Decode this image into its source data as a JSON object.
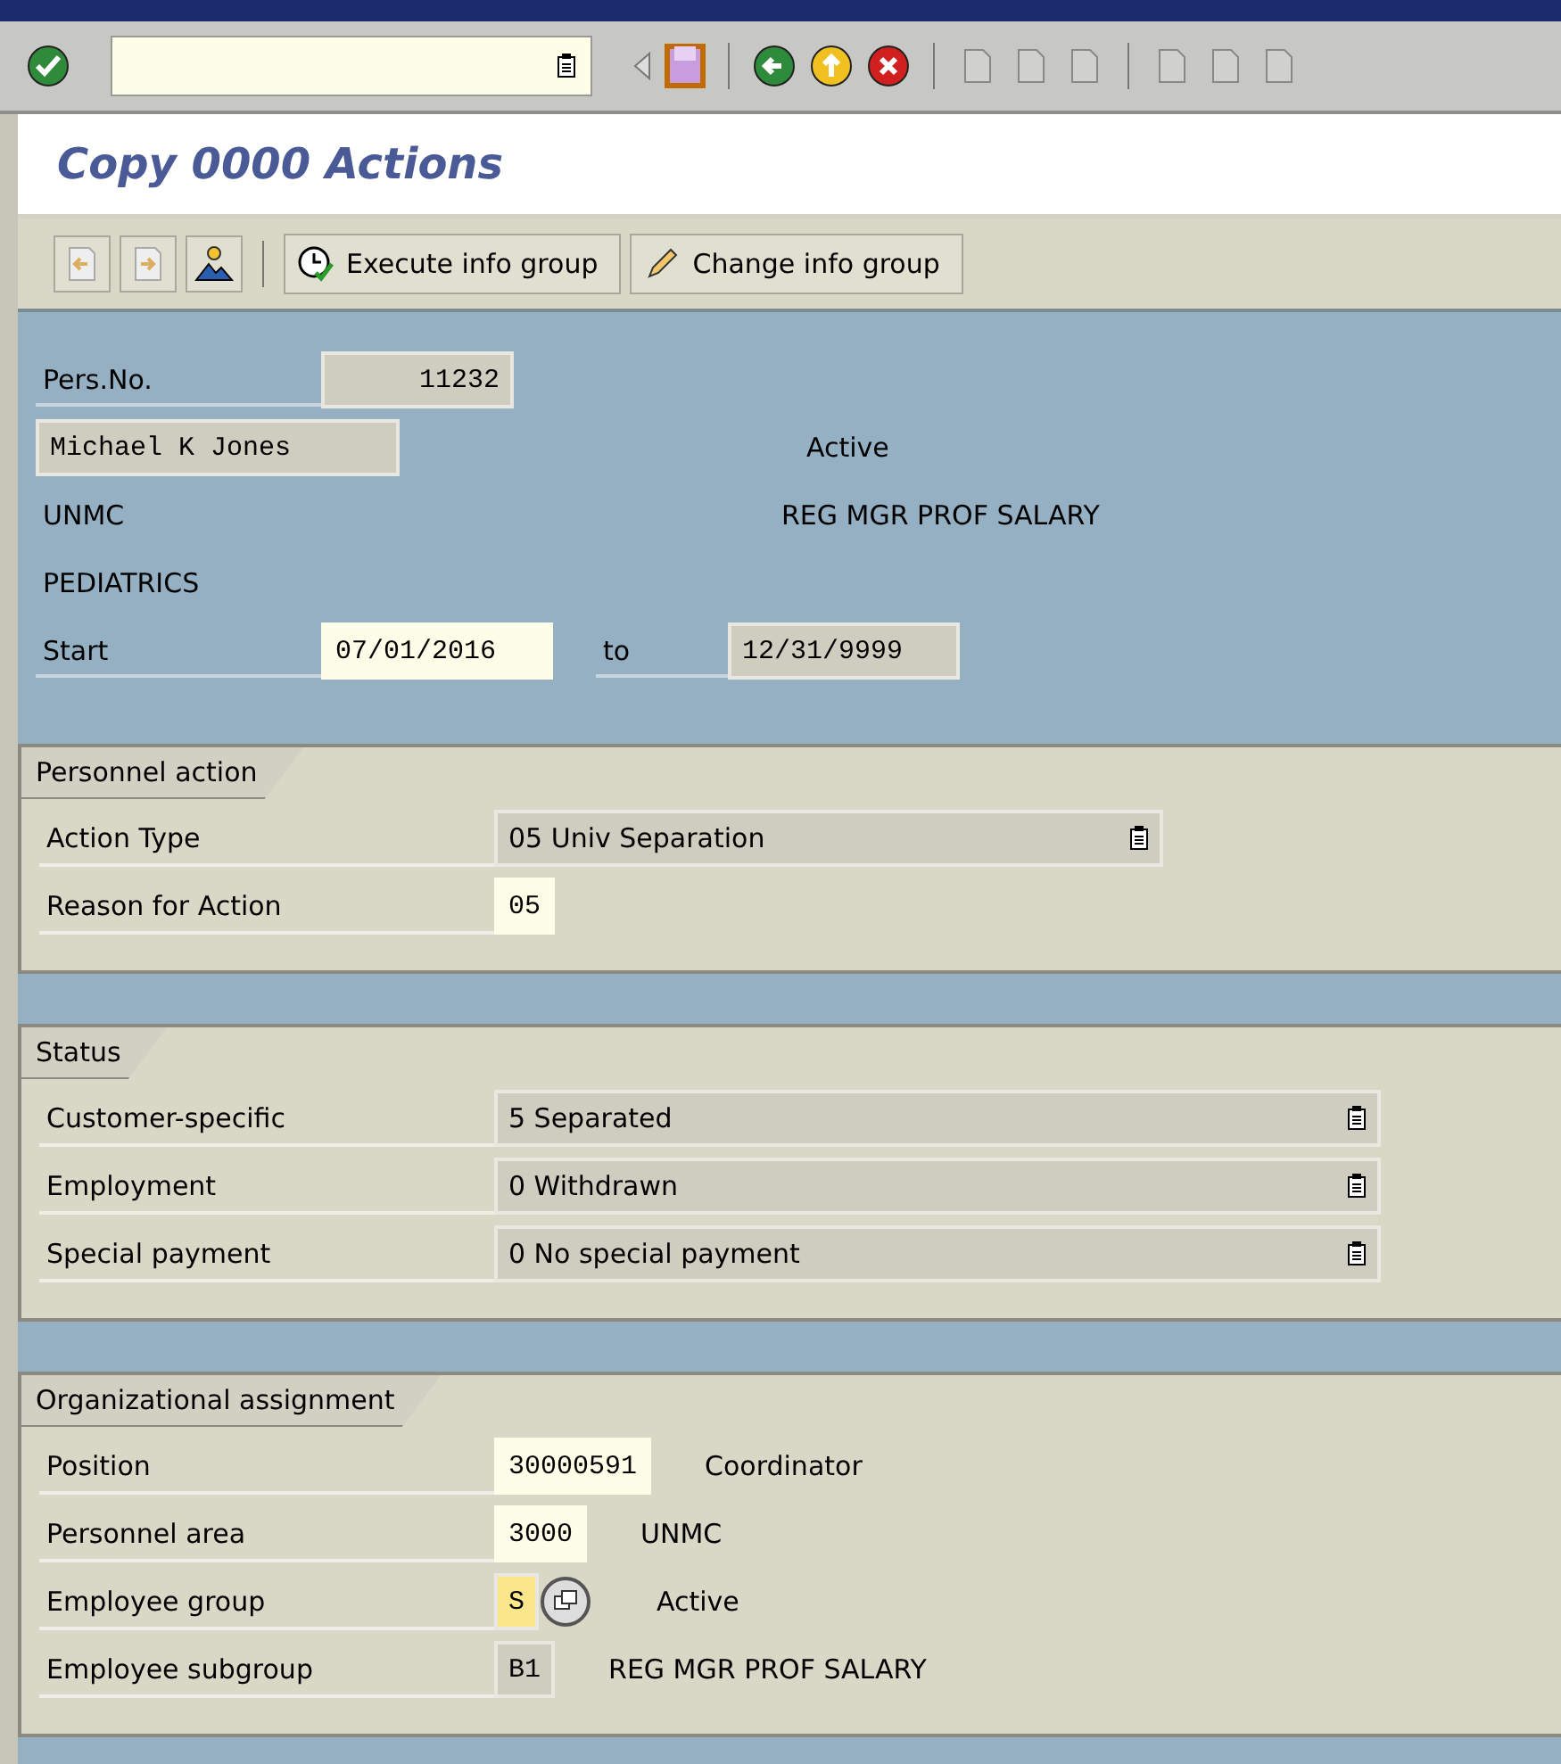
{
  "title": "Copy 0000 Actions",
  "app_toolbar": [
    {
      "label": "Execute info group"
    },
    {
      "label": "Change info group"
    }
  ],
  "header": {
    "pers_no": {
      "label": "Pers.No.",
      "value": "11232"
    },
    "name": "Michael K Jones",
    "status": "Active",
    "org": "UNMC",
    "pay": "REG MGR PROF SALARY",
    "dept": "PEDIATRICS",
    "period": {
      "start_label": "Start",
      "start": "07/01/2016",
      "to_label": "to",
      "end": "12/31/9999"
    }
  },
  "groups": [
    {
      "title": "Personnel action",
      "rows": [
        {
          "label": "Action Type",
          "field": {
            "value": "05 Univ Separation",
            "kind": "dropdown"
          }
        },
        {
          "label": "Reason for Action",
          "field": {
            "value": "05",
            "kind": "editable"
          }
        }
      ]
    },
    {
      "title": "Status",
      "rows": [
        {
          "label": "Customer-specific",
          "field": {
            "value": "5 Separated",
            "kind": "dropdown"
          }
        },
        {
          "label": "Employment",
          "field": {
            "value": "0 Withdrawn",
            "kind": "dropdown"
          }
        },
        {
          "label": "Special payment",
          "field": {
            "value": "0 No special payment",
            "kind": "dropdown"
          }
        }
      ]
    },
    {
      "title": "Organizational assignment",
      "rows": [
        {
          "label": "Position",
          "field": {
            "value": "30000591",
            "kind": "editable"
          },
          "text": "Coordinator"
        },
        {
          "label": "Personnel area",
          "field": {
            "value": "3000",
            "kind": "editable"
          },
          "text": "UNMC"
        },
        {
          "label": "Employee group",
          "field": {
            "value": "S",
            "kind": "focused"
          },
          "text": "Active"
        },
        {
          "label": "Employee subgroup",
          "field": {
            "value": "B1",
            "kind": "readonly"
          },
          "text": "REG MGR PROF SALARY"
        }
      ]
    }
  ]
}
